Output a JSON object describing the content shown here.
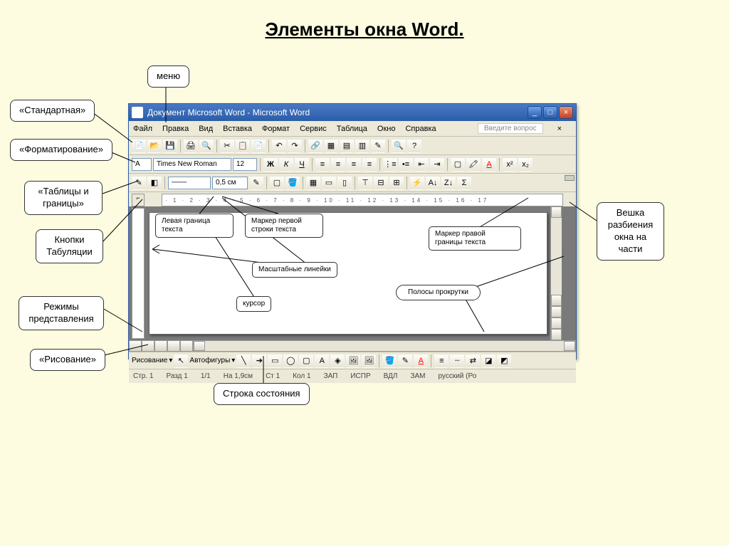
{
  "title": "Элементы окна Word.",
  "callouts": {
    "menu": "меню",
    "standard": "«Стандартная»",
    "formatting": "«Форматирование»",
    "tables_borders": "«Таблицы и границы»",
    "tab_buttons": "Кнопки Табуляции",
    "view_modes": "Режимы представления",
    "drawing": "«Рисование»",
    "status_line": "Строка состояния",
    "split_handle": "Вешка разбиения окна на части",
    "left_margin": "Левая граница текста",
    "first_line": "Маркер первой строки текста",
    "right_margin": "Маркер правой границы текста",
    "rulers": "Масштабные линейки",
    "cursor": "курсор",
    "scrollbars": "Полосы прокрутки"
  },
  "window": {
    "title": "Документ Microsoft Word - Microsoft Word",
    "ask_question": "Введите вопрос",
    "menu": [
      "Файл",
      "Правка",
      "Вид",
      "Вставка",
      "Формат",
      "Сервис",
      "Таблица",
      "Окно",
      "Справка"
    ],
    "formatting": {
      "font": "Times New Roman",
      "size": "12",
      "indent": "0,5 см"
    },
    "drawing_label": "Рисование",
    "autoshapes": "Автофигуры",
    "ruler_text": "· 1 · 2 · 3 · 4 · 5 · 6 · 7 · 8 · 9 · 10 · 11 · 12 · 13 · 14 · 15 · 16 · 17",
    "status": {
      "page": "Стр. 1",
      "section": "Разд 1",
      "pages": "1/1",
      "at": "На 1,9см",
      "line": "Ст 1",
      "col": "Кол 1",
      "rec": "ЗАП",
      "fix": "ИСПР",
      "ext": "ВДЛ",
      "ovr": "ЗАМ",
      "lang": "русский (Ро"
    }
  }
}
